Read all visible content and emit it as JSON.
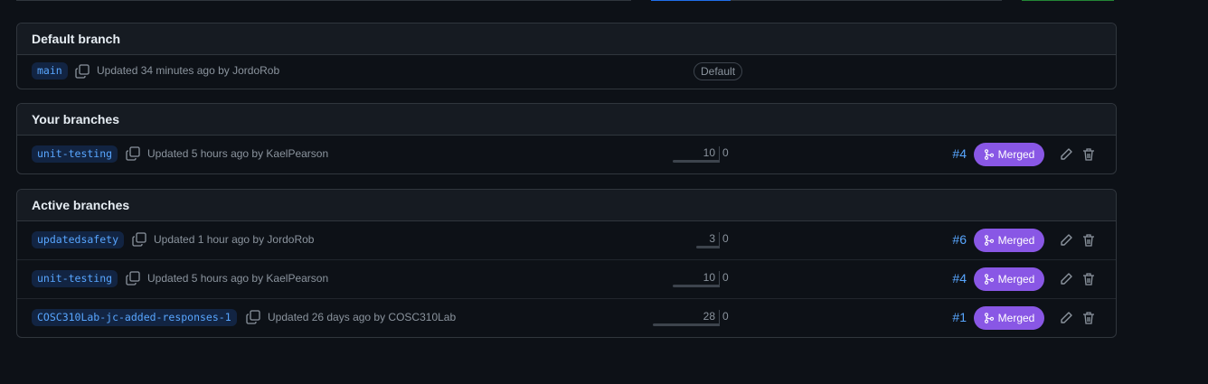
{
  "colors": {
    "background": "#0d1117",
    "header_bg": "#161b22",
    "border": "#30363d",
    "link": "#58a6ff",
    "merged": "#8957e5"
  },
  "default_section": {
    "title": "Default branch",
    "branch": {
      "name": "main",
      "updated": "Updated 34 minutes ago by JordoRob",
      "badge": "Default"
    }
  },
  "your_section": {
    "title": "Your branches",
    "branches": [
      {
        "name": "unit-testing",
        "updated": "Updated 5 hours ago by KaelPearson",
        "behind": "10",
        "ahead": "0",
        "pr": "#4",
        "status": "Merged"
      }
    ]
  },
  "active_section": {
    "title": "Active branches",
    "branches": [
      {
        "name": "updatedsafety",
        "updated": "Updated 1 hour ago by JordoRob",
        "behind": "3",
        "ahead": "0",
        "pr": "#6",
        "status": "Merged"
      },
      {
        "name": "unit-testing",
        "updated": "Updated 5 hours ago by KaelPearson",
        "behind": "10",
        "ahead": "0",
        "pr": "#4",
        "status": "Merged"
      },
      {
        "name": "COSC310Lab-jc-added-responses-1",
        "updated": "Updated 26 days ago by COSC310Lab",
        "behind": "28",
        "ahead": "0",
        "pr": "#1",
        "status": "Merged"
      }
    ]
  }
}
